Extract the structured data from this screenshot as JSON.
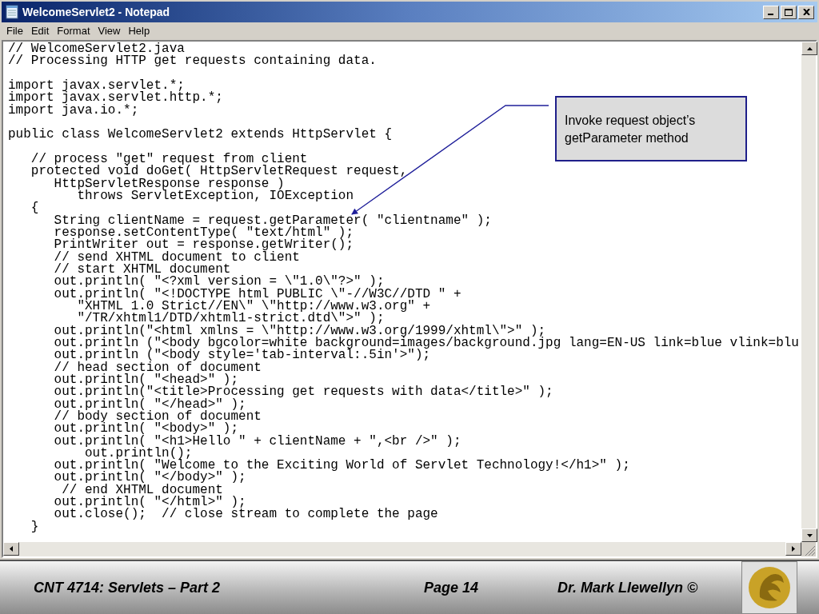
{
  "window": {
    "title": "WelcomeServlet2 - Notepad"
  },
  "menu": [
    "File",
    "Edit",
    "Format",
    "View",
    "Help"
  ],
  "code_blocks": [
    [
      "// WelcomeServlet2.java",
      "// Processing HTTP get requests containing data."
    ],
    [
      "import javax.servlet.*;",
      "import javax.servlet.http.*;",
      "import java.io.*;"
    ],
    [
      "public class WelcomeServlet2 extends HttpServlet {"
    ],
    [
      "   // process \"get\" request from client",
      "   protected void doGet( HttpServletRequest request,",
      "      HttpServletResponse response )",
      "         throws ServletException, IOException",
      "   {",
      "      String clientName = request.getParameter( \"clientname\" );",
      "      response.setContentType( \"text/html\" );",
      "      PrintWriter out = response.getWriter();",
      "      // send XHTML document to client",
      "      // start XHTML document",
      "      out.println( \"<?xml version = \\\"1.0\\\"?>\" );",
      "      out.println( \"<!DOCTYPE html PUBLIC \\\"-//W3C//DTD \" +",
      "         \"XHTML 1.0 Strict//EN\\\" \\\"http://www.w3.org\" +",
      "         \"/TR/xhtml1/DTD/xhtml1-strict.dtd\\\">\" );",
      "      out.println(\"<html xmlns = \\\"http://www.w3.org/1999/xhtml\\\">\" );",
      "      out.println (\"<body bgcolor=white background=images/background.jpg lang=EN-US link=blue vlink=blu",
      "      out.println (\"<body style='tab-interval:.5in'>\");",
      "      // head section of document",
      "      out.println( \"<head>\" );",
      "      out.println(\"<title>Processing get requests with data</title>\" );",
      "      out.println( \"</head>\" );",
      "      // body section of document",
      "      out.println( \"<body>\" );",
      "      out.println( \"<h1>Hello \" + clientName + \",<br />\" );",
      "          out.println();",
      "      out.println( \"Welcome to the Exciting World of Servlet Technology!</h1>\" );",
      "      out.println( \"</body>\" );",
      "       // end XHTML document",
      "      out.println( \"</html>\" );",
      "      out.close();  // close stream to complete the page",
      "   }"
    ]
  ],
  "callout": {
    "text": "Invoke request object’s getParameter method"
  },
  "footer": {
    "course": "CNT 4714: Servlets – Part 2",
    "page": "Page 14",
    "author": "Dr. Mark Llewellyn ©"
  }
}
